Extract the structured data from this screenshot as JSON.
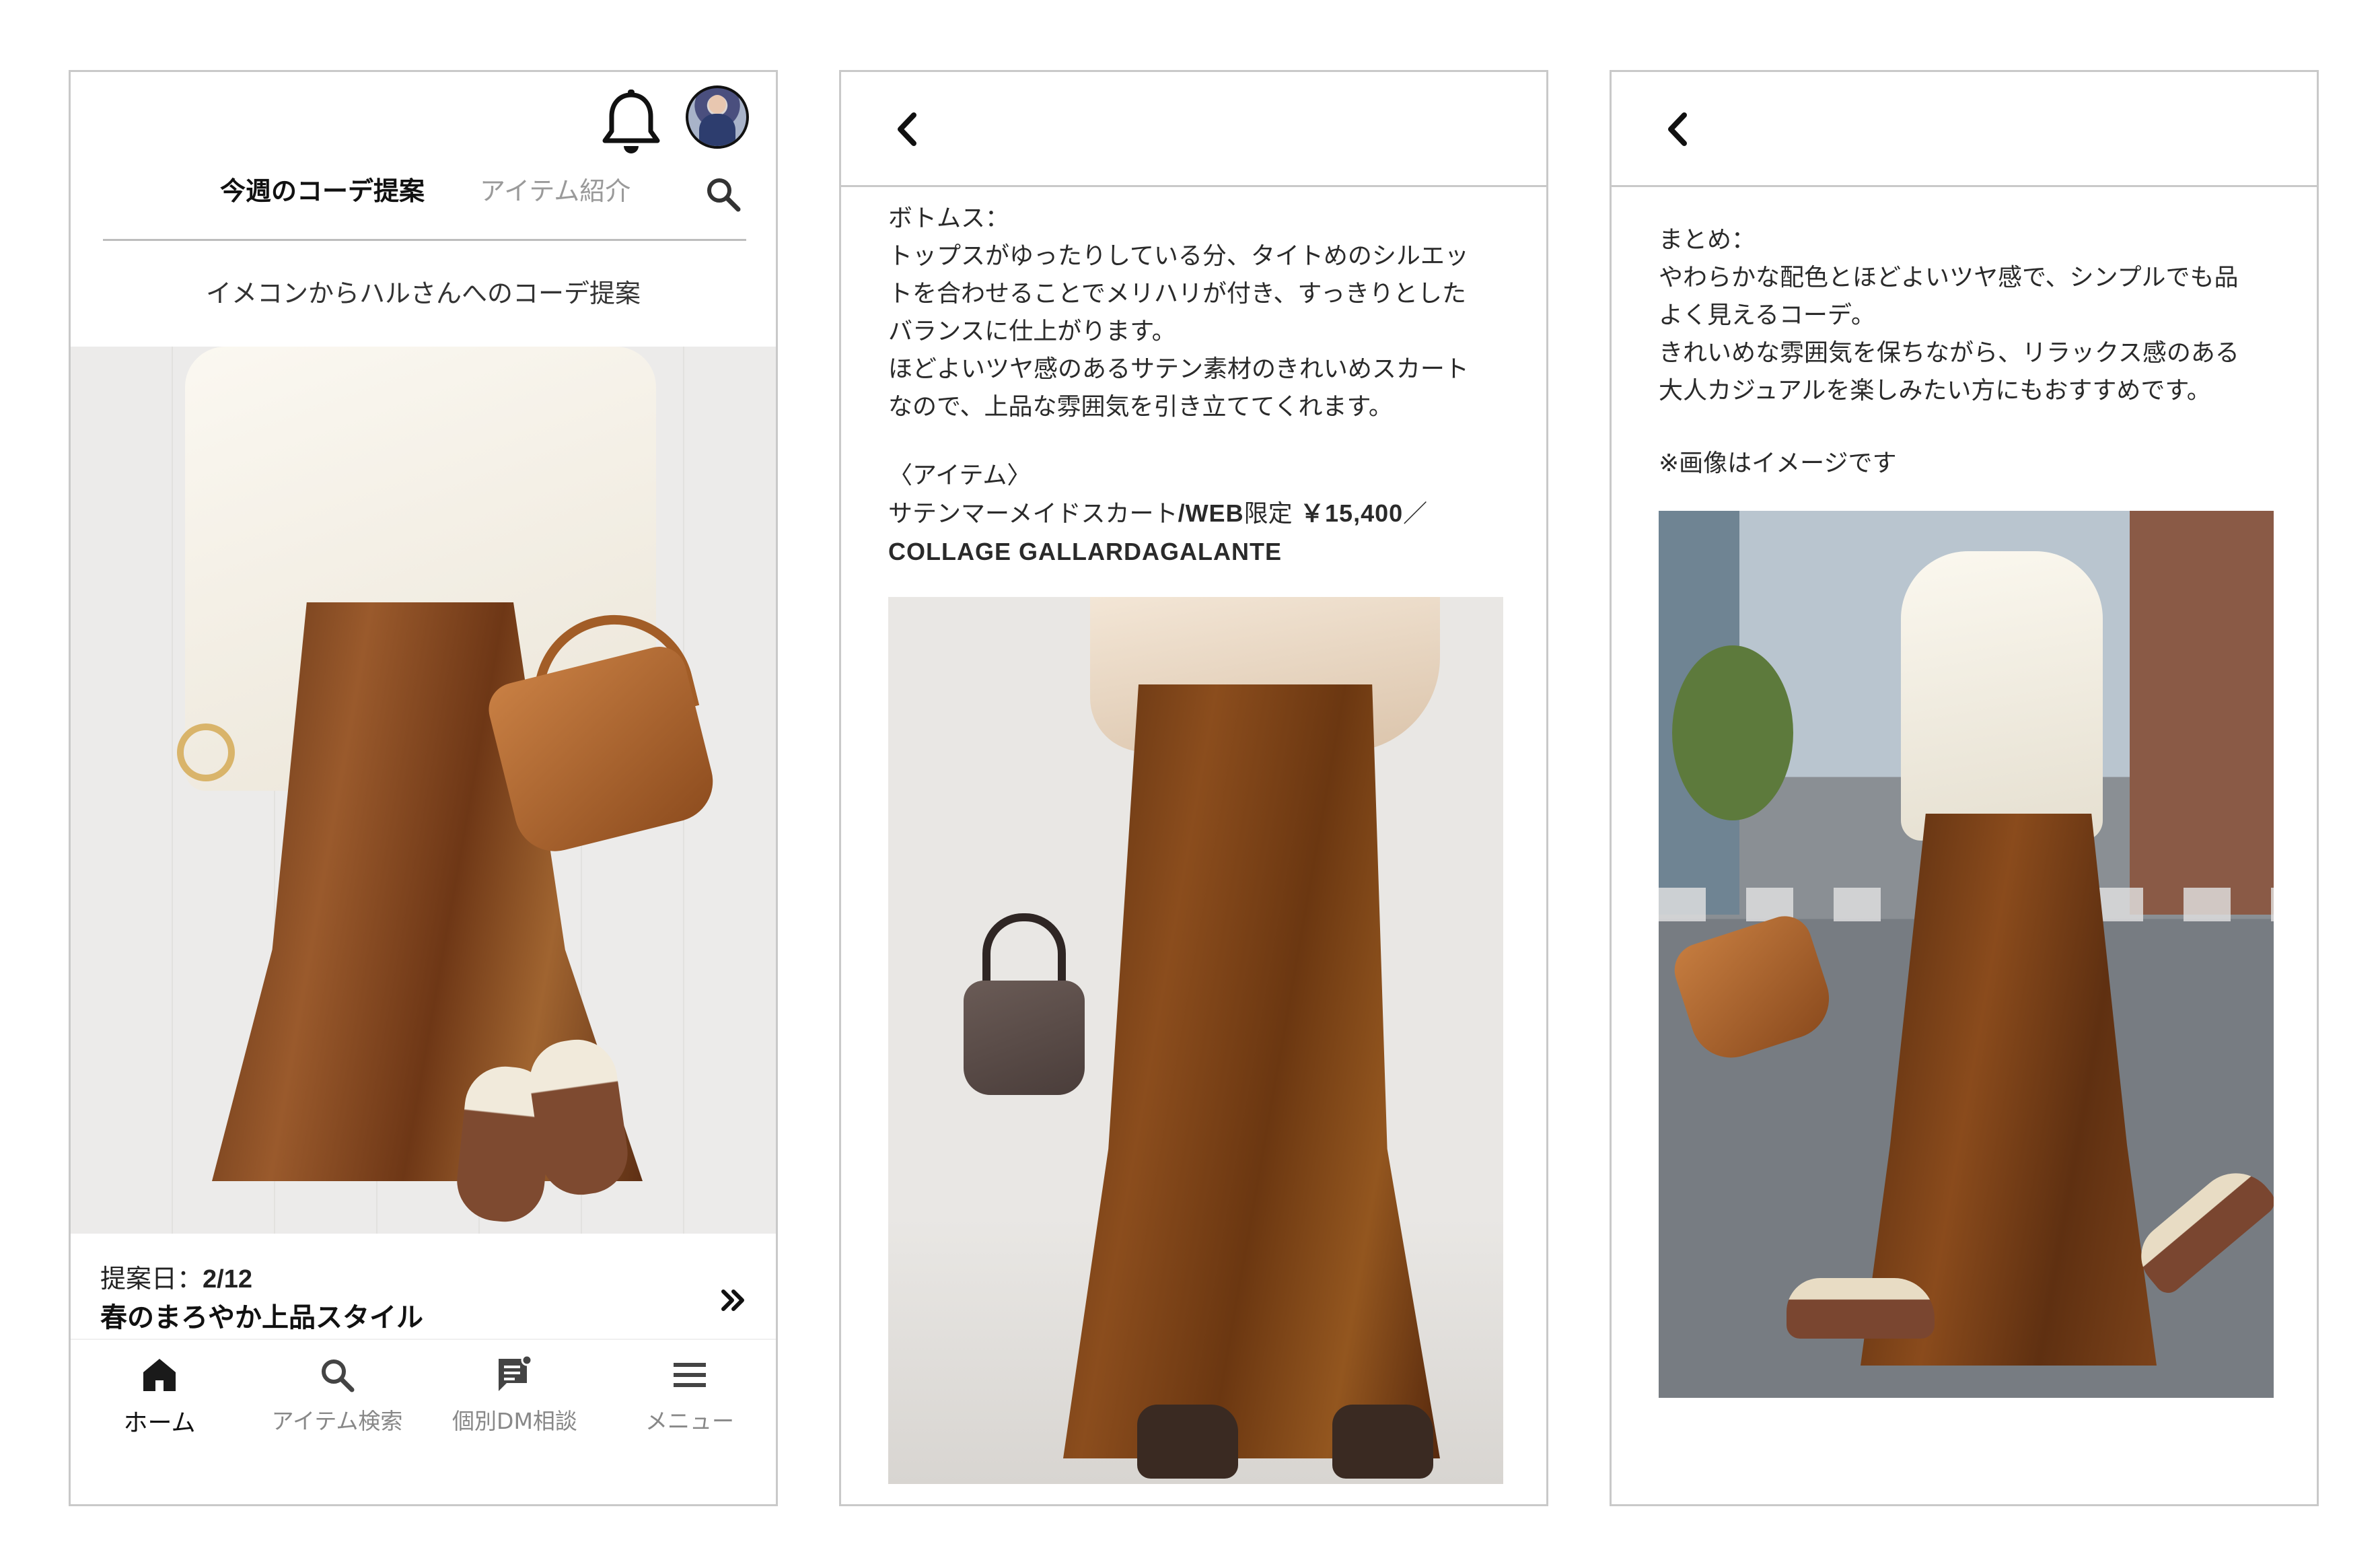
{
  "colors": {
    "text_primary": "#111111",
    "text_muted": "#9a9a9a",
    "divider": "#bdbdbd",
    "frame_border": "#c9c9c9",
    "skirt_brown": "#7a4018"
  },
  "home": {
    "header_icons": [
      "bell-icon",
      "avatar"
    ],
    "tabs": [
      {
        "label": "今週のコーデ提案",
        "active": true
      },
      {
        "label": "アイテム紹介",
        "active": false
      }
    ],
    "subtitle": "イメコンからハルさんへのコーデ提案",
    "card": {
      "date_label": "提案日：",
      "date_value": "2/12",
      "title": "春のまろやか上品スタイル",
      "more_icon": "double-chevron-right-icon"
    },
    "bottom_nav": [
      {
        "label": "ホーム",
        "icon": "home-icon",
        "active": true
      },
      {
        "label": "アイテム検索",
        "icon": "search-icon",
        "active": false
      },
      {
        "label": "個別DM相談",
        "icon": "chat-icon",
        "active": false
      },
      {
        "label": "メニュー",
        "icon": "menu-icon",
        "active": false
      }
    ]
  },
  "detail_bottoms": {
    "back_icon": "back-chevron-icon",
    "lines": [
      "ボトムス：",
      "トップスがゆったりしている分、タイトめのシルエッ",
      "トを合わせることでメリハリが付き、すっきりとした",
      "バランスに仕上がります。",
      "ほどよいツヤ感のあるサテン素材のきれいめスカート",
      "なので、上品な雰囲気を引き立ててくれます。"
    ],
    "item_heading": "〈アイテム〉",
    "item_name": "サテンマーメイドスカート",
    "item_sep": "/",
    "item_tag": "WEB",
    "item_limited": "限定 ",
    "item_price": "￥15,400",
    "item_slash": "／",
    "item_brand": "COLLAGE GALLARDAGALANTE"
  },
  "detail_summary": {
    "back_icon": "back-chevron-icon",
    "lines": [
      "まとめ：",
      "やわらかな配色とほどよいツヤ感で、シンプルでも品",
      "よく見えるコーデ。",
      "きれいめな雰囲気を保ちながら、リラックス感のある",
      "大人カジュアルを楽しみたい方にもおすすめです。"
    ],
    "note": "※画像はイメージです"
  }
}
